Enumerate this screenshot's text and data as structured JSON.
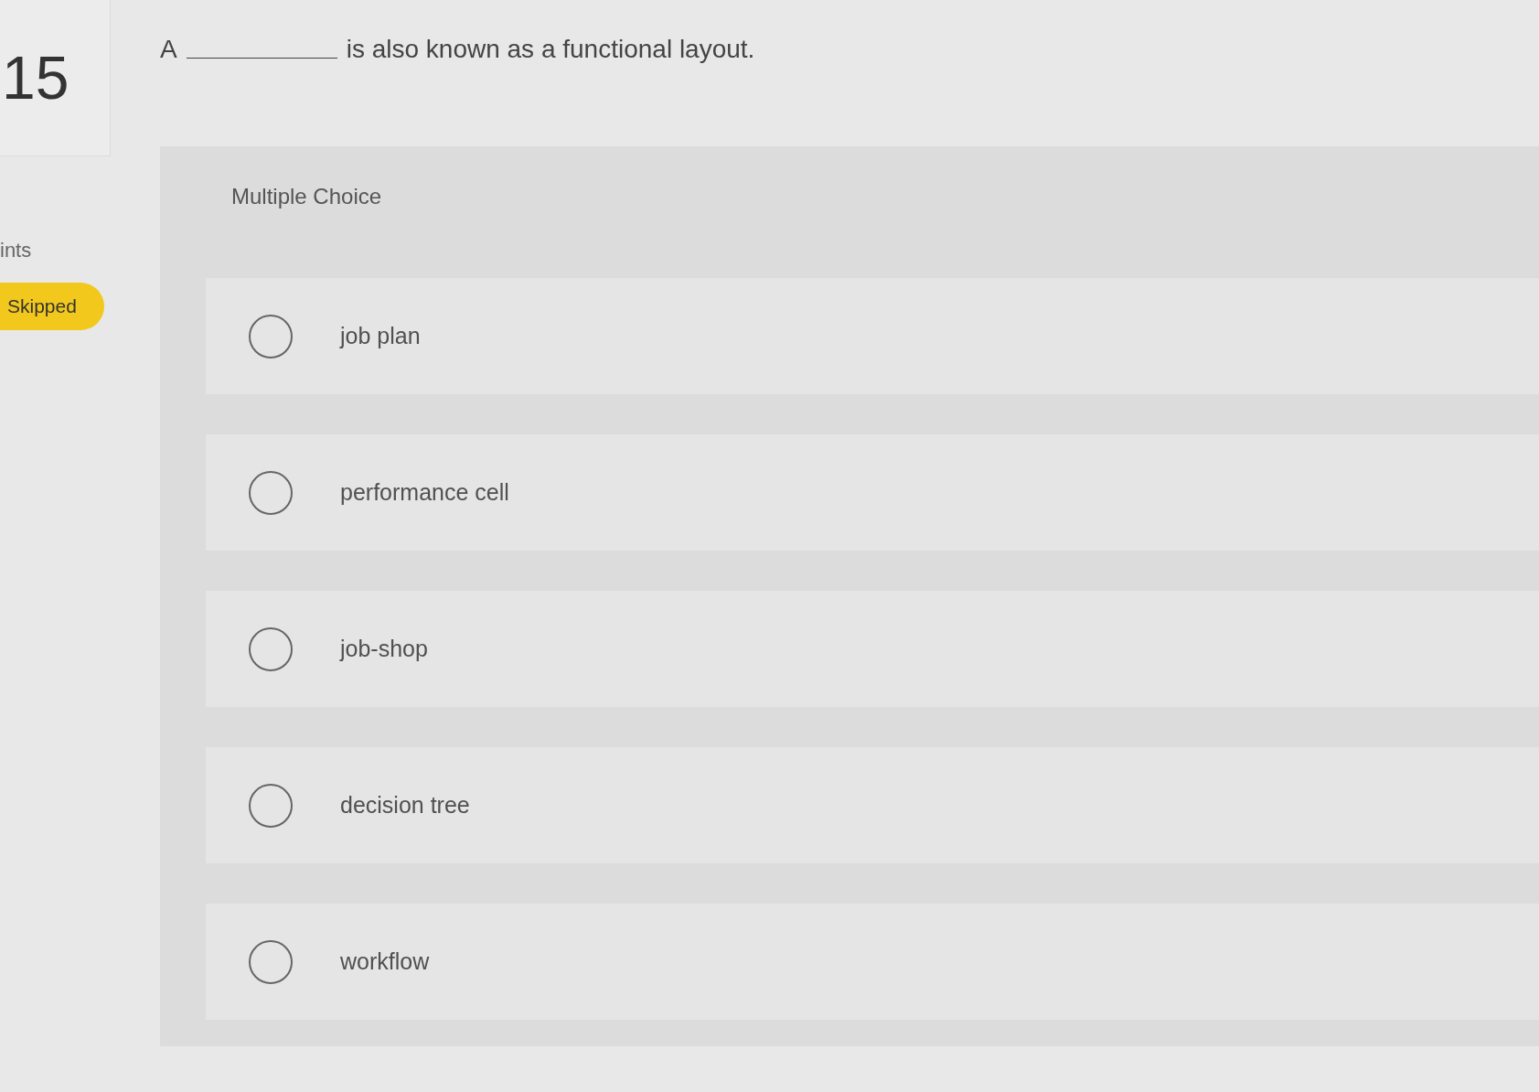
{
  "question": {
    "number": "15",
    "prefix": "A",
    "suffix": "is also known as a functional layout."
  },
  "sidebar": {
    "points_label": "ints",
    "status": "Skipped"
  },
  "answer_panel": {
    "title": "Multiple Choice",
    "options": [
      {
        "label": "job plan",
        "selected": false
      },
      {
        "label": "performance cell",
        "selected": false
      },
      {
        "label": "job-shop",
        "selected": false
      },
      {
        "label": "decision tree",
        "selected": false
      },
      {
        "label": "workflow",
        "selected": false
      }
    ]
  }
}
